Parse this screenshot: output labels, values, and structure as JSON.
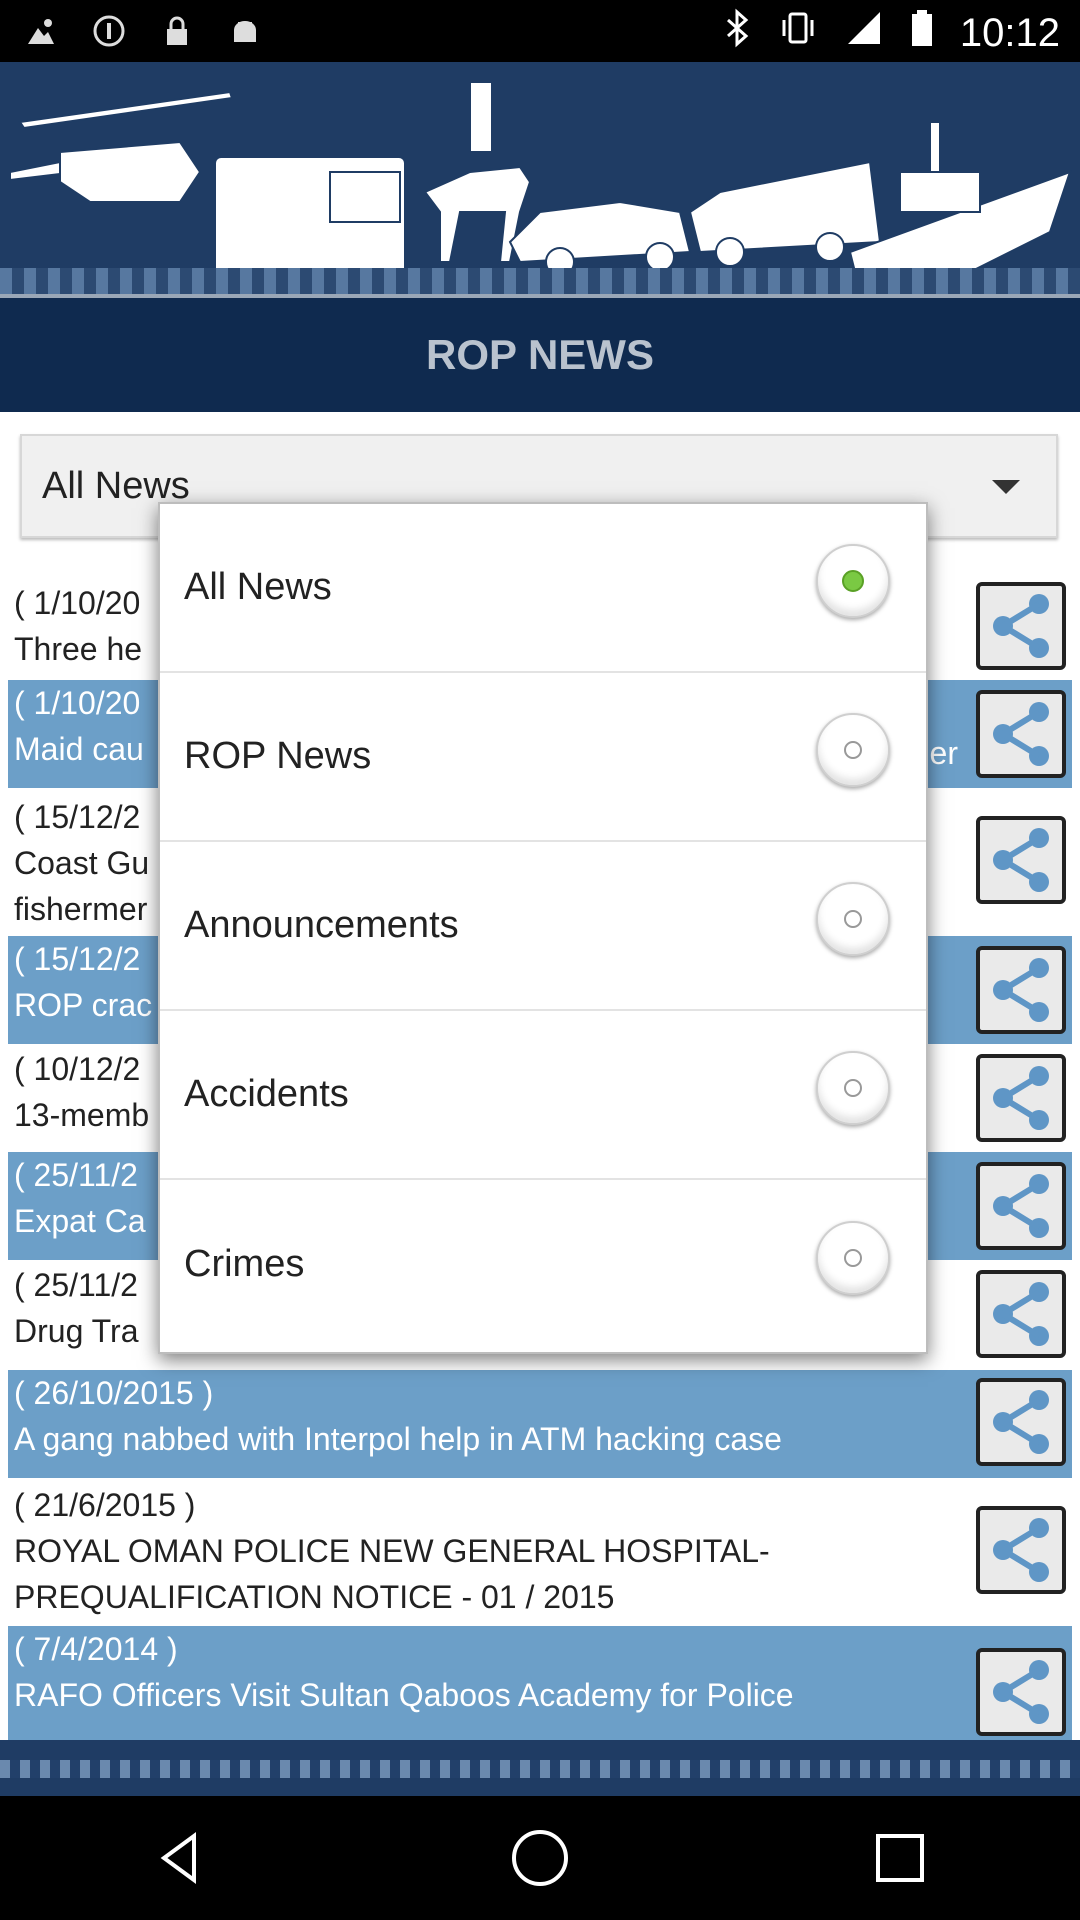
{
  "status_bar": {
    "time": "10:12",
    "left_icons": [
      "gallery-icon",
      "info-circle-icon",
      "lock-icon",
      "android-icon"
    ],
    "right_icons": [
      "bluetooth-icon",
      "vibrate-icon",
      "signal-icon",
      "battery-icon"
    ]
  },
  "header": {
    "title": "ROP NEWS"
  },
  "filter": {
    "selected": "All News"
  },
  "news": [
    {
      "date": "( 1/10/20",
      "headline": "Three he",
      "alt": false
    },
    {
      "date": "( 1/10/20",
      "headline": "Maid cau",
      "tail": "er",
      "alt": true
    },
    {
      "date": "( 15/12/2",
      "headline": "Coast Gu",
      "line3": "fishermer",
      "alt": false
    },
    {
      "date": "( 15/12/2",
      "headline": "ROP crac",
      "alt": true
    },
    {
      "date": "( 10/12/2",
      "headline": "13-memb",
      "alt": false
    },
    {
      "date": "( 25/11/2",
      "headline": "Expat Ca",
      "alt": true
    },
    {
      "date": "( 25/11/2",
      "headline": "Drug Tra",
      "alt": false
    },
    {
      "date": "( 26/10/2015 )",
      "headline": "A gang nabbed with Interpol help in ATM hacking case",
      "alt": true
    },
    {
      "date": "( 21/6/2015 )",
      "headline": "ROYAL OMAN POLICE NEW GENERAL HOSPITAL-",
      "line3": "PREQUALIFICATION NOTICE -  01 / 2015",
      "alt": false
    },
    {
      "date": "( 7/4/2014 )",
      "headline": "RAFO Officers Visit Sultan Qaboos Academy for Police",
      "alt": true
    }
  ],
  "dialog": {
    "options": [
      {
        "label": "All News",
        "selected": true
      },
      {
        "label": "ROP News",
        "selected": false
      },
      {
        "label": "Announcements",
        "selected": false
      },
      {
        "label": "Accidents",
        "selected": false
      },
      {
        "label": "Crimes",
        "selected": false
      }
    ]
  },
  "colors": {
    "header_bg": "#0f2a4f",
    "banner_bg": "#1f3c64",
    "row_alt": "#6c9fc8",
    "radio_selected": "#7ac943"
  },
  "nav": {
    "icons": [
      "back-icon",
      "home-icon",
      "recents-icon"
    ]
  }
}
